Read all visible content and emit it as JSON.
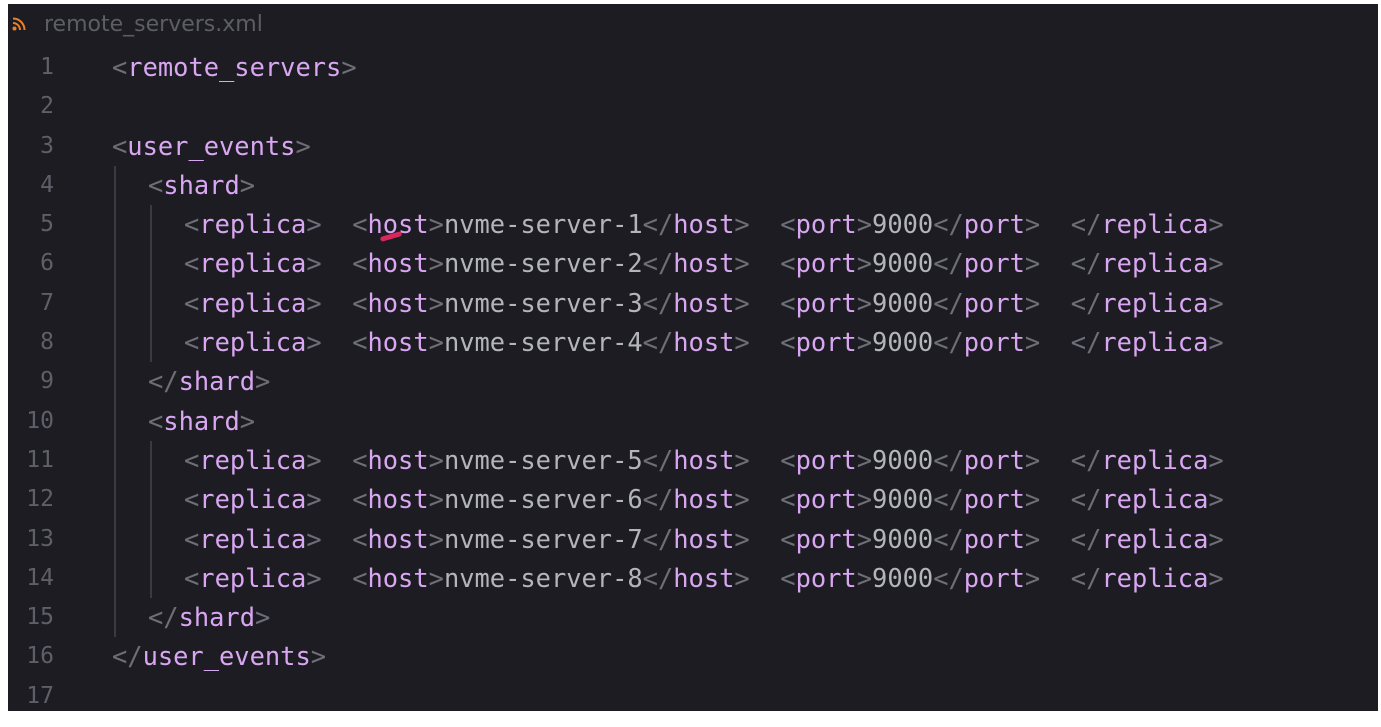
{
  "tab": {
    "icon": "rss-icon",
    "filename": "remote_servers.xml"
  },
  "colors": {
    "background": "#1c1c22",
    "tag": "#d9a6f2",
    "punctuation": "#6e6e78",
    "text": "#b4b4bc",
    "line_number": "#5f5f6a",
    "tab_icon": "#e8822a",
    "cursor_mark": "#d9265b"
  },
  "lines": [
    {
      "n": "1",
      "indent": 0,
      "tokens": [
        [
          "p",
          "<"
        ],
        [
          "t",
          "remote_servers"
        ],
        [
          "p",
          ">"
        ]
      ]
    },
    {
      "n": "2",
      "indent": 0,
      "tokens": []
    },
    {
      "n": "3",
      "indent": 0,
      "tokens": [
        [
          "p",
          "<"
        ],
        [
          "t",
          "user_events"
        ],
        [
          "p",
          ">"
        ]
      ]
    },
    {
      "n": "4",
      "indent": 1,
      "tokens": [
        [
          "p",
          "<"
        ],
        [
          "t",
          "shard"
        ],
        [
          "p",
          ">"
        ]
      ]
    },
    {
      "n": "5",
      "indent": 2,
      "tokens": [
        [
          "p",
          "<"
        ],
        [
          "t",
          "replica"
        ],
        [
          "p",
          ">"
        ],
        [
          "v",
          "  "
        ],
        [
          "p",
          "<"
        ],
        [
          "t",
          "host"
        ],
        [
          "p",
          ">"
        ],
        [
          "v",
          "nvme-server-1"
        ],
        [
          "p",
          "</"
        ],
        [
          "t",
          "host"
        ],
        [
          "p",
          ">"
        ],
        [
          "v",
          "  "
        ],
        [
          "p",
          "<"
        ],
        [
          "t",
          "port"
        ],
        [
          "p",
          ">"
        ],
        [
          "v",
          "9000"
        ],
        [
          "p",
          "</"
        ],
        [
          "t",
          "port"
        ],
        [
          "p",
          ">"
        ],
        [
          "v",
          "  "
        ],
        [
          "p",
          "</"
        ],
        [
          "t",
          "replica"
        ],
        [
          "p",
          ">"
        ]
      ]
    },
    {
      "n": "6",
      "indent": 2,
      "tokens": [
        [
          "p",
          "<"
        ],
        [
          "t",
          "replica"
        ],
        [
          "p",
          ">"
        ],
        [
          "v",
          "  "
        ],
        [
          "p",
          "<"
        ],
        [
          "t",
          "host"
        ],
        [
          "p",
          ">"
        ],
        [
          "v",
          "nvme-server-2"
        ],
        [
          "p",
          "</"
        ],
        [
          "t",
          "host"
        ],
        [
          "p",
          ">"
        ],
        [
          "v",
          "  "
        ],
        [
          "p",
          "<"
        ],
        [
          "t",
          "port"
        ],
        [
          "p",
          ">"
        ],
        [
          "v",
          "9000"
        ],
        [
          "p",
          "</"
        ],
        [
          "t",
          "port"
        ],
        [
          "p",
          ">"
        ],
        [
          "v",
          "  "
        ],
        [
          "p",
          "</"
        ],
        [
          "t",
          "replica"
        ],
        [
          "p",
          ">"
        ]
      ]
    },
    {
      "n": "7",
      "indent": 2,
      "tokens": [
        [
          "p",
          "<"
        ],
        [
          "t",
          "replica"
        ],
        [
          "p",
          ">"
        ],
        [
          "v",
          "  "
        ],
        [
          "p",
          "<"
        ],
        [
          "t",
          "host"
        ],
        [
          "p",
          ">"
        ],
        [
          "v",
          "nvme-server-3"
        ],
        [
          "p",
          "</"
        ],
        [
          "t",
          "host"
        ],
        [
          "p",
          ">"
        ],
        [
          "v",
          "  "
        ],
        [
          "p",
          "<"
        ],
        [
          "t",
          "port"
        ],
        [
          "p",
          ">"
        ],
        [
          "v",
          "9000"
        ],
        [
          "p",
          "</"
        ],
        [
          "t",
          "port"
        ],
        [
          "p",
          ">"
        ],
        [
          "v",
          "  "
        ],
        [
          "p",
          "</"
        ],
        [
          "t",
          "replica"
        ],
        [
          "p",
          ">"
        ]
      ]
    },
    {
      "n": "8",
      "indent": 2,
      "tokens": [
        [
          "p",
          "<"
        ],
        [
          "t",
          "replica"
        ],
        [
          "p",
          ">"
        ],
        [
          "v",
          "  "
        ],
        [
          "p",
          "<"
        ],
        [
          "t",
          "host"
        ],
        [
          "p",
          ">"
        ],
        [
          "v",
          "nvme-server-4"
        ],
        [
          "p",
          "</"
        ],
        [
          "t",
          "host"
        ],
        [
          "p",
          ">"
        ],
        [
          "v",
          "  "
        ],
        [
          "p",
          "<"
        ],
        [
          "t",
          "port"
        ],
        [
          "p",
          ">"
        ],
        [
          "v",
          "9000"
        ],
        [
          "p",
          "</"
        ],
        [
          "t",
          "port"
        ],
        [
          "p",
          ">"
        ],
        [
          "v",
          "  "
        ],
        [
          "p",
          "</"
        ],
        [
          "t",
          "replica"
        ],
        [
          "p",
          ">"
        ]
      ]
    },
    {
      "n": "9",
      "indent": 1,
      "tokens": [
        [
          "p",
          "</"
        ],
        [
          "t",
          "shard"
        ],
        [
          "p",
          ">"
        ]
      ]
    },
    {
      "n": "10",
      "indent": 1,
      "tokens": [
        [
          "p",
          "<"
        ],
        [
          "t",
          "shard"
        ],
        [
          "p",
          ">"
        ]
      ]
    },
    {
      "n": "11",
      "indent": 2,
      "tokens": [
        [
          "p",
          "<"
        ],
        [
          "t",
          "replica"
        ],
        [
          "p",
          ">"
        ],
        [
          "v",
          "  "
        ],
        [
          "p",
          "<"
        ],
        [
          "t",
          "host"
        ],
        [
          "p",
          ">"
        ],
        [
          "v",
          "nvme-server-5"
        ],
        [
          "p",
          "</"
        ],
        [
          "t",
          "host"
        ],
        [
          "p",
          ">"
        ],
        [
          "v",
          "  "
        ],
        [
          "p",
          "<"
        ],
        [
          "t",
          "port"
        ],
        [
          "p",
          ">"
        ],
        [
          "v",
          "9000"
        ],
        [
          "p",
          "</"
        ],
        [
          "t",
          "port"
        ],
        [
          "p",
          ">"
        ],
        [
          "v",
          "  "
        ],
        [
          "p",
          "</"
        ],
        [
          "t",
          "replica"
        ],
        [
          "p",
          ">"
        ]
      ]
    },
    {
      "n": "12",
      "indent": 2,
      "tokens": [
        [
          "p",
          "<"
        ],
        [
          "t",
          "replica"
        ],
        [
          "p",
          ">"
        ],
        [
          "v",
          "  "
        ],
        [
          "p",
          "<"
        ],
        [
          "t",
          "host"
        ],
        [
          "p",
          ">"
        ],
        [
          "v",
          "nvme-server-6"
        ],
        [
          "p",
          "</"
        ],
        [
          "t",
          "host"
        ],
        [
          "p",
          ">"
        ],
        [
          "v",
          "  "
        ],
        [
          "p",
          "<"
        ],
        [
          "t",
          "port"
        ],
        [
          "p",
          ">"
        ],
        [
          "v",
          "9000"
        ],
        [
          "p",
          "</"
        ],
        [
          "t",
          "port"
        ],
        [
          "p",
          ">"
        ],
        [
          "v",
          "  "
        ],
        [
          "p",
          "</"
        ],
        [
          "t",
          "replica"
        ],
        [
          "p",
          ">"
        ]
      ]
    },
    {
      "n": "13",
      "indent": 2,
      "tokens": [
        [
          "p",
          "<"
        ],
        [
          "t",
          "replica"
        ],
        [
          "p",
          ">"
        ],
        [
          "v",
          "  "
        ],
        [
          "p",
          "<"
        ],
        [
          "t",
          "host"
        ],
        [
          "p",
          ">"
        ],
        [
          "v",
          "nvme-server-7"
        ],
        [
          "p",
          "</"
        ],
        [
          "t",
          "host"
        ],
        [
          "p",
          ">"
        ],
        [
          "v",
          "  "
        ],
        [
          "p",
          "<"
        ],
        [
          "t",
          "port"
        ],
        [
          "p",
          ">"
        ],
        [
          "v",
          "9000"
        ],
        [
          "p",
          "</"
        ],
        [
          "t",
          "port"
        ],
        [
          "p",
          ">"
        ],
        [
          "v",
          "  "
        ],
        [
          "p",
          "</"
        ],
        [
          "t",
          "replica"
        ],
        [
          "p",
          ">"
        ]
      ]
    },
    {
      "n": "14",
      "indent": 2,
      "tokens": [
        [
          "p",
          "<"
        ],
        [
          "t",
          "replica"
        ],
        [
          "p",
          ">"
        ],
        [
          "v",
          "  "
        ],
        [
          "p",
          "<"
        ],
        [
          "t",
          "host"
        ],
        [
          "p",
          ">"
        ],
        [
          "v",
          "nvme-server-8"
        ],
        [
          "p",
          "</"
        ],
        [
          "t",
          "host"
        ],
        [
          "p",
          ">"
        ],
        [
          "v",
          "  "
        ],
        [
          "p",
          "<"
        ],
        [
          "t",
          "port"
        ],
        [
          "p",
          ">"
        ],
        [
          "v",
          "9000"
        ],
        [
          "p",
          "</"
        ],
        [
          "t",
          "port"
        ],
        [
          "p",
          ">"
        ],
        [
          "v",
          "  "
        ],
        [
          "p",
          "</"
        ],
        [
          "t",
          "replica"
        ],
        [
          "p",
          ">"
        ]
      ]
    },
    {
      "n": "15",
      "indent": 1,
      "tokens": [
        [
          "p",
          "</"
        ],
        [
          "t",
          "shard"
        ],
        [
          "p",
          ">"
        ]
      ]
    },
    {
      "n": "16",
      "indent": 0,
      "tokens": [
        [
          "p",
          "</"
        ],
        [
          "t",
          "user_events"
        ],
        [
          "p",
          ">"
        ]
      ]
    },
    {
      "n": "17",
      "indent": 0,
      "tokens": []
    }
  ]
}
